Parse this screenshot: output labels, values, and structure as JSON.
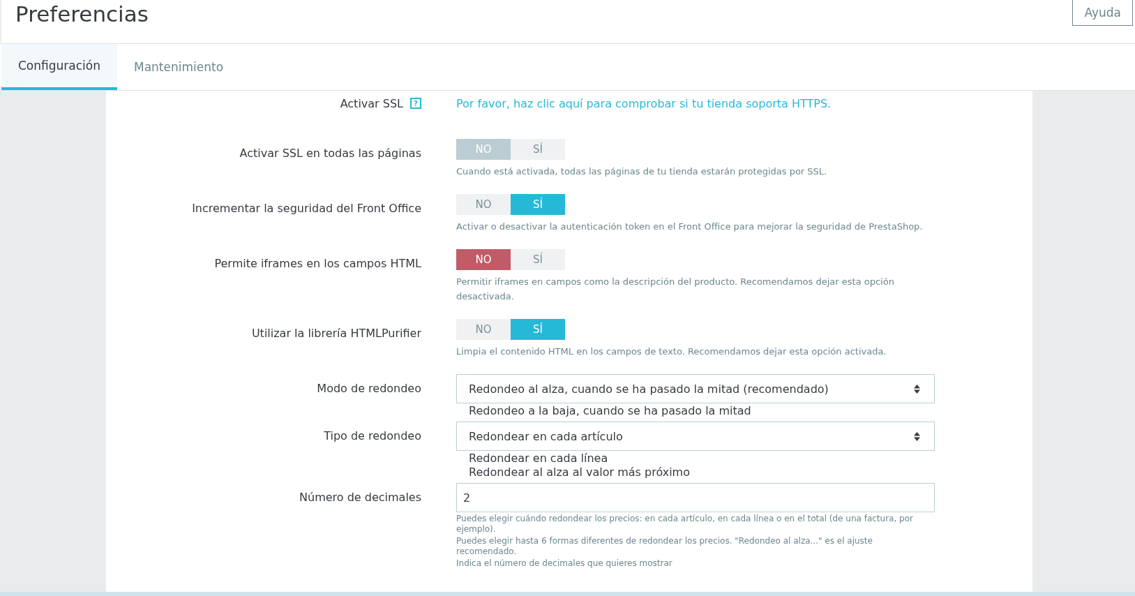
{
  "header": {
    "title": "Preferencias",
    "help_button": "Ayuda"
  },
  "tabs": [
    {
      "label": "Configuración",
      "selected": true
    },
    {
      "label": "Mantenimiento",
      "selected": false
    }
  ],
  "rows": [
    {
      "kind": "link",
      "label": "Activar SSL",
      "help_icon": "?",
      "link": "Por favor, haz clic aquí para comprobar si tu tienda soporta HTTPS."
    },
    {
      "kind": "toggle",
      "label": "Activar SSL en todas las páginas",
      "color": "#bbcdd2",
      "options": [
        {
          "label": "NO",
          "selected": true
        },
        {
          "label": "SÍ",
          "selected": false
        }
      ],
      "help": [
        "Cuando está activada, todas las páginas de tu tienda estarán protegidas por SSL."
      ]
    },
    {
      "kind": "toggle",
      "label": "Incrementar la seguridad del Front Office",
      "color": "#25b9d7",
      "options": [
        {
          "label": "NO",
          "selected": false
        },
        {
          "label": "SÍ",
          "selected": true
        }
      ],
      "help": [
        "Activar o desactivar la autenticación token en el Front Office para mejorar la seguridad de PrestaShop."
      ]
    },
    {
      "kind": "toggle",
      "label": "Permite iframes en los campos HTML",
      "color": "#c05c67",
      "options": [
        {
          "label": "NO",
          "selected": true
        },
        {
          "label": "SÍ",
          "selected": false
        }
      ],
      "help": [
        "Permitir iframes en campos como la descripción del producto. Recomendamos dejar esta opción desactivada."
      ]
    },
    {
      "kind": "toggle",
      "label": "Utilizar la librería HTMLPurifier",
      "color": "#25b9d7",
      "options": [
        {
          "label": "NO",
          "selected": false
        },
        {
          "label": "SÍ",
          "selected": true
        }
      ],
      "help": [
        "Limpia el contenido HTML en los campos de texto. Recomendamos dejar esta opción activada."
      ]
    },
    {
      "kind": "select",
      "label": "Modo de redondeo",
      "value": "Redondeo al alza, cuando se ha pasado la mitad (recomendado)",
      "options": [
        "Redondeo a la baja, cuando se ha pasado la mitad"
      ]
    },
    {
      "kind": "select",
      "label": "Tipo de redondeo",
      "value": "Redondear en cada artículo",
      "options": [
        "Redondear en cada línea",
        "Redondear al alza al valor más próximo"
      ]
    },
    {
      "kind": "input",
      "label": "Número de decimales",
      "value": "2",
      "help": [
        "Puedes elegir cuándo redondear los precios: en cada artículo, en cada línea o en el total (de una factura, por ejemplo).",
        "Puedes elegir hasta 6 formas diferentes de redondear los precios. \"Redondeo al alza...\" es el ajuste recomendado.",
        "Indica el número de decimales que quieres mostrar"
      ]
    }
  ]
}
